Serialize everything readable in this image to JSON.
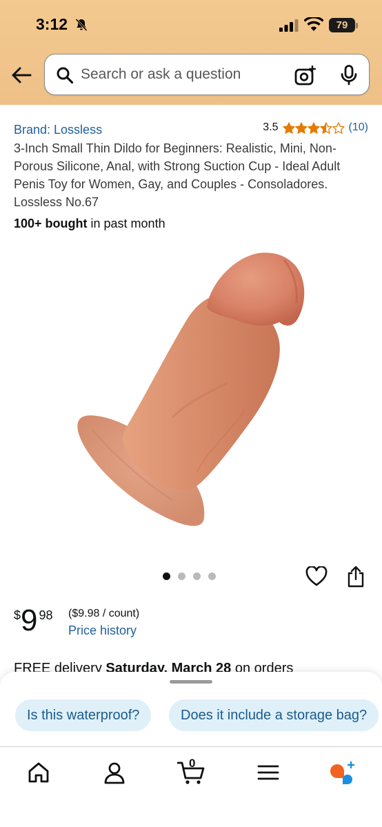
{
  "status_bar": {
    "time": "3:12",
    "battery": "79",
    "icons": [
      "bell-slash-icon",
      "cellular-signal-icon",
      "wifi-icon",
      "battery-icon"
    ]
  },
  "search": {
    "placeholder": "Search or ask a question",
    "icons": [
      "back-arrow-icon",
      "search-icon",
      "camera-lens-icon",
      "microphone-icon"
    ]
  },
  "product": {
    "brand": "Brand: Lossless",
    "rating_value": "3.5",
    "stars": 3.5,
    "rating_count": "(10)",
    "title": "3-Inch Small Thin Dildo for Beginners: Realistic, Mini, Non-Porous Silicone, Anal, with Strong Suction Cup - Ideal Adult Penis Toy for Women, Gay, and Couples - Consoladores. Lossless No.67",
    "bought_bold": "100+ bought",
    "bought_rest": " in past month",
    "image_count": 4,
    "active_image": 1
  },
  "price": {
    "currency": "$",
    "whole": "9",
    "fraction": "98",
    "unit_price": "($9.98 / count)",
    "history_link": "Price history"
  },
  "delivery": {
    "prefix": "FREE delivery ",
    "date": "Saturday, March 28",
    "suffix": " on orders"
  },
  "suggestions": [
    "Is this waterproof?",
    "Does it include a storage bag?"
  ],
  "nav": {
    "cart_count": "0",
    "items": [
      "home-icon",
      "account-icon",
      "cart-icon",
      "menu-icon",
      "rufus-icon"
    ]
  },
  "colors": {
    "header_bg": "#f3c98f",
    "link": "#1f5f9e",
    "star": "#e67a00",
    "chip_bg": "#dff0f8",
    "rufus_orange": "#f2631f",
    "rufus_blue": "#1a8fe3"
  }
}
